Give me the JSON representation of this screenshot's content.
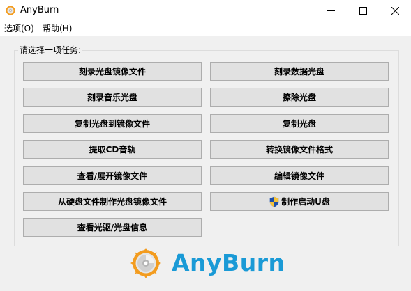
{
  "window": {
    "title": "AnyBurn"
  },
  "menu": {
    "options": "选项(O)",
    "help": "帮助(H)"
  },
  "group": {
    "title": "请选择一项任务:"
  },
  "buttons": {
    "burn_image": "刻录光盘镜像文件",
    "burn_data": "刻录数据光盘",
    "burn_audio": "刻录音乐光盘",
    "erase": "擦除光盘",
    "copy_to_image": "复制光盘到镜像文件",
    "copy_disc": "复制光盘",
    "rip_cd": "提取CD音轨",
    "convert_image": "转换镜像文件格式",
    "browse_image": "查看/展开镜像文件",
    "edit_image": "编辑镜像文件",
    "create_from_files": "从硬盘文件制作光盘镜像文件",
    "create_usb": "制作启动U盘",
    "drive_info": "查看光驱/光盘信息"
  },
  "brand": {
    "name": "AnyBurn"
  },
  "colors": {
    "brand_blue": "#1a9ad6",
    "logo_orange": "#f39c1f",
    "button_face": "#e1e1e1",
    "button_border": "#adadad",
    "window_bg": "#f0f0f0"
  }
}
